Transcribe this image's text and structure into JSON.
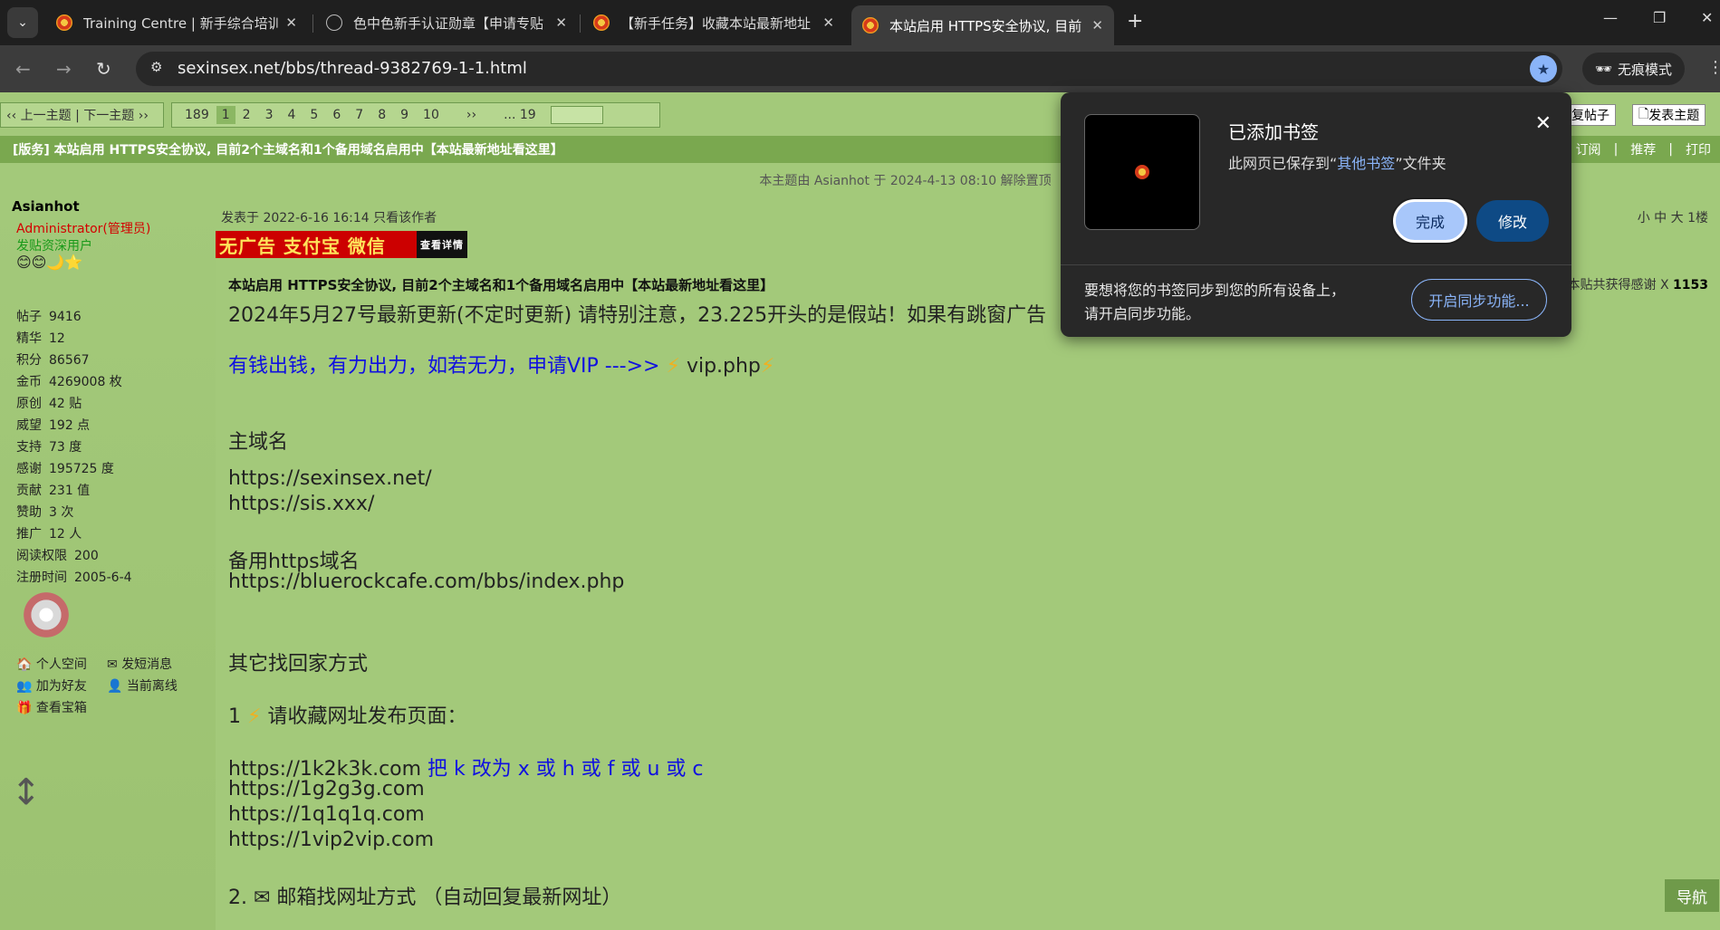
{
  "browser": {
    "tabs": [
      {
        "title": "Training Centre | 新手综合培训"
      },
      {
        "title": "色中色新手认证勋章【申请专贴"
      },
      {
        "title": "【新手任务】收藏本站最新地址"
      },
      {
        "title": "本站启用 HTTPS安全协议, 目前"
      }
    ],
    "url": "sexinsex.net/bbs/thread-9382769-1-1.html",
    "incognito_label": "无痕模式"
  },
  "forum": {
    "prev_next": "‹‹ 上一主题 | 下一主题 ››",
    "pager": {
      "total": "189",
      "pages": [
        "1",
        "2",
        "3",
        "4",
        "5",
        "6",
        "7",
        "8",
        "9",
        "10"
      ],
      "current": "1",
      "next": "››",
      "last": "... 19"
    },
    "reply_btn": "复帖子",
    "new_btn": "发表主题",
    "thread_title": "[版务] 本站启用 HTTPS安全协议, 目前2个主域名和1个备用域名启用中【本站最新地址看这里】",
    "title_links": [
      "订阅",
      "推荐",
      "打印"
    ],
    "notice": "本主题由 Asianhot 于 2024-4-13 08:10 解除置顶",
    "user": {
      "name": "Asianhot",
      "role1": "Administrator(管理员)",
      "role2": "发贴资深用户",
      "stats": [
        {
          "k": "帖子",
          "v": "9416"
        },
        {
          "k": "精华",
          "v": "12"
        },
        {
          "k": "积分",
          "v": "86567"
        },
        {
          "k": "金币",
          "v": "4269008 枚"
        },
        {
          "k": "原创",
          "v": "42 贴"
        },
        {
          "k": "威望",
          "v": "192 点"
        },
        {
          "k": "支持",
          "v": "73 度"
        },
        {
          "k": "感谢",
          "v": "195725 度"
        },
        {
          "k": "贡献",
          "v": "231 值"
        },
        {
          "k": "赞助",
          "v": "3 次"
        },
        {
          "k": "推广",
          "v": "12 人"
        },
        {
          "k": "阅读权限",
          "v": "200"
        },
        {
          "k": "注册时间",
          "v": "2005-6-4"
        }
      ],
      "links": [
        "个人空间",
        "发短消息",
        "加为好友",
        "当前离线",
        "查看宝箱"
      ]
    },
    "post": {
      "meta": "发表于 2022-6-16 16:14  只看该作者",
      "floor": "小 中 大  1楼",
      "ad_text": "无广告 支付宝 微信",
      "ad_tag": "查看详情",
      "title": "本站启用 HTTPS安全协议, 目前2个主域名和1个备用域名启用中【本站最新地址看这里】",
      "thanks_label": "本贴共获得感谢 X",
      "thanks_value": "1153",
      "lines": {
        "update": "2024年5月27号最新更新(不定时更新) 请特别注意，23.225开头的是假站！如果有跳窗广告",
        "vip_prefix": "有钱出钱，有力出力，如若无力，申请VIP --->> ",
        "vip_link": "vip.php",
        "main_domain": "主域名",
        "d1": "https://sexinsex.net/",
        "d2": "https://sis.xxx/",
        "backup": "备用https域名",
        "d3": "https://bluerockcafe.com/bbs/index.php",
        "other": "其它找回家方式",
        "s1": "1  ",
        "s1_text": " 请收藏网址发布页面：",
        "u1": "https://1k2k3k.com",
        "u1_note": "  把 k 改为 x 或 h 或 f 或 u 或 c",
        "u2": "https://1g2g3g.com",
        "u3": "https://1q1q1q.com",
        "u4": "https://1vip2vip.com",
        "s2": "2. ",
        "s2_text": " 邮箱找网址方式 （自动回复最新网址）"
      }
    },
    "nav_float": "导航"
  },
  "bookmark_popup": {
    "title": "已添加书签",
    "desc_prefix": "此网页已保存到“",
    "desc_folder": "其他书签",
    "desc_suffix": "”文件夹",
    "done": "完成",
    "edit": "修改",
    "sync_text": "要想将您的书签同步到您的所有设备上，请开启同步功能。",
    "sync_btn": "开启同步功能..."
  }
}
